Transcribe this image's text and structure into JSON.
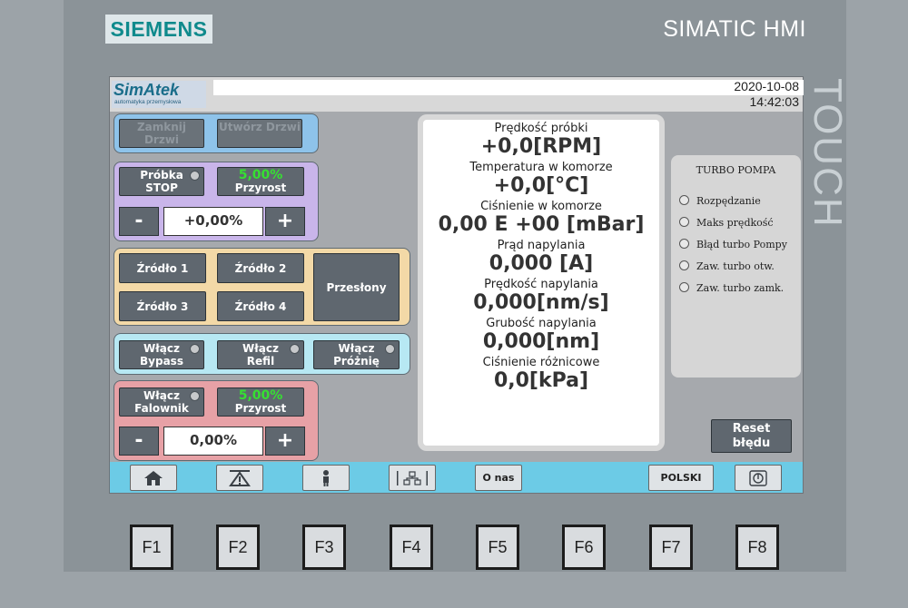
{
  "device": {
    "brand": "SIEMENS",
    "model": "SIMATIC HMI",
    "side_label": "TOUCH"
  },
  "topbar": {
    "logo": "SimAtek",
    "logo_sub": "automatyka przemysłowa",
    "date": "2020-10-08",
    "time": "14:42:03"
  },
  "door": {
    "close_label": "Zamknij Drzwi",
    "open_label": "Utwórz Drzwi"
  },
  "sample": {
    "state_line1": "Próbka",
    "state_line2": "STOP",
    "increment_value": "5,00%",
    "increment_label": "Przyrost",
    "minus": "-",
    "plus": "+",
    "value": "+0,00%"
  },
  "sources": {
    "s1": "Źródło 1",
    "s2": "Źródło 2",
    "s3": "Źródło 3",
    "s4": "Źródło 4",
    "shutters": "Przesłony"
  },
  "switches": {
    "bypass_l1": "Włącz",
    "bypass_l2": "Bypass",
    "refil_l1": "Włącz",
    "refil_l2": "Refil",
    "vacuum_l1": "Włącz",
    "vacuum_l2": "Próżnię"
  },
  "inverter": {
    "line1": "Włącz",
    "line2": "Falownik",
    "increment_value": "5,00%",
    "increment_label": "Przyrost",
    "minus": "-",
    "plus": "+",
    "value": "0,00%"
  },
  "readings": [
    {
      "label": "Prędkość próbki",
      "value": "+0,0[RPM]"
    },
    {
      "label": "Temperatura w komorze",
      "value": "+0,0[°C]"
    },
    {
      "label": "Ciśnienie w komorze",
      "value": "0,00 E +00 [mBar]"
    },
    {
      "label": "Prąd napylania",
      "value": "0,000 [A]"
    },
    {
      "label": "Prędkość napylania",
      "value": "0,000[nm/s]"
    },
    {
      "label": "Grubość napylania",
      "value": "0,000[nm]"
    },
    {
      "label": "Ciśnienie różnicowe",
      "value": "0,0[kPa]"
    }
  ],
  "turbo": {
    "title": "TURBO POMPA",
    "items": [
      "Rozpędzanie",
      "Maks prędkość",
      "Błąd turbo Pompy",
      "Zaw. turbo otw.",
      "Zaw. turbo zamk."
    ]
  },
  "reset": {
    "line1": "Reset",
    "line2": "błędu"
  },
  "nav": {
    "home_icon": "home-icon",
    "alarm_icon": "alarm-icon",
    "user_icon": "user-icon",
    "network_icon": "network-icon",
    "about": "O nas",
    "language": "POLSKI",
    "power_icon": "power-icon"
  },
  "fkeys": [
    "F1",
    "F2",
    "F3",
    "F4",
    "F5",
    "F6",
    "F7",
    "F8"
  ]
}
